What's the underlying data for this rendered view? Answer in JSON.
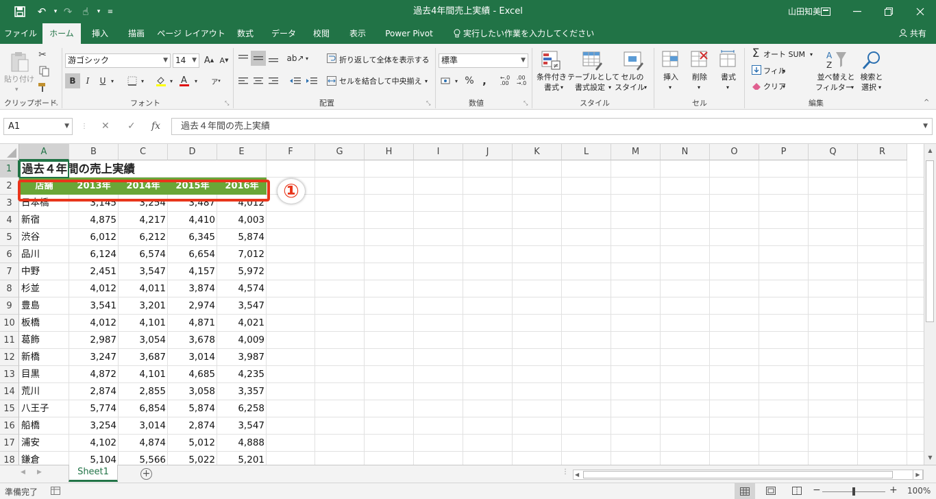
{
  "window": {
    "title": "過去4年間売上実績  -  Excel",
    "user": "山田知美"
  },
  "quick_access": {
    "save_icon": "save-icon",
    "undo_icon": "undo-icon",
    "redo_icon": "redo-icon",
    "touch_icon": "touch-mode-icon",
    "customize_icon": "customize-icon"
  },
  "tabs": [
    {
      "label": "ファイル"
    },
    {
      "label": "ホーム"
    },
    {
      "label": "挿入"
    },
    {
      "label": "描画"
    },
    {
      "label": "ページ レイアウト"
    },
    {
      "label": "数式"
    },
    {
      "label": "データ"
    },
    {
      "label": "校閲"
    },
    {
      "label": "表示"
    },
    {
      "label": "Power Pivot"
    },
    {
      "label": "実行したい作業を入力してください"
    }
  ],
  "share_label": "共有",
  "ribbon": {
    "clipboard": {
      "label": "クリップボード",
      "paste": "貼り付け"
    },
    "font": {
      "label": "フォント",
      "font_name": "游ゴシック",
      "font_size": "14",
      "bold": "B",
      "italic": "I",
      "underline": "U"
    },
    "alignment": {
      "label": "配置",
      "wrap": "折り返して全体を表示する",
      "merge": "セルを結合して中央揃え"
    },
    "number": {
      "label": "数値",
      "format": "標準",
      "percent": "%",
      "comma": ","
    },
    "styles": {
      "label": "スタイル",
      "conditional_1": "条件付き",
      "conditional_2": "書式",
      "table_1": "テーブルとして",
      "table_2": "書式設定",
      "cell_1": "セルの",
      "cell_2": "スタイル"
    },
    "cells": {
      "label": "セル",
      "insert": "挿入",
      "delete": "削除",
      "format": "書式"
    },
    "editing": {
      "label": "編集",
      "autosum": "オート SUM",
      "fill": "フィル",
      "clear": "クリア",
      "sort_1": "並べ替えと",
      "sort_2": "フィルター",
      "find_1": "検索と",
      "find_2": "選択"
    }
  },
  "formula_bar": {
    "name_box": "A1",
    "cancel": "✕",
    "enter": "✓",
    "fx": "fx",
    "content": "過去４年間の売上実績"
  },
  "sheet": {
    "columns": [
      "A",
      "B",
      "C",
      "D",
      "E",
      "F",
      "G",
      "H",
      "I",
      "J",
      "K",
      "L",
      "M",
      "N",
      "O",
      "P",
      "Q",
      "R"
    ],
    "row_numbers": [
      "1",
      "2",
      "3",
      "4",
      "5",
      "6",
      "7",
      "8",
      "9",
      "10",
      "11",
      "12",
      "13",
      "14",
      "15",
      "16",
      "17",
      "18"
    ],
    "title": "過去４年間の売上実績",
    "headers": [
      "店舗",
      "2013年",
      "2014年",
      "2015年",
      "2016年"
    ],
    "rows": [
      [
        "日本橋",
        "3,145",
        "3,254",
        "3,487",
        "4,012"
      ],
      [
        "新宿",
        "4,875",
        "4,217",
        "4,410",
        "4,003"
      ],
      [
        "渋谷",
        "6,012",
        "6,212",
        "6,345",
        "5,874"
      ],
      [
        "品川",
        "6,124",
        "6,574",
        "6,654",
        "7,012"
      ],
      [
        "中野",
        "2,451",
        "3,547",
        "4,157",
        "5,972"
      ],
      [
        "杉並",
        "4,012",
        "4,011",
        "3,874",
        "4,574"
      ],
      [
        "豊島",
        "3,541",
        "3,201",
        "2,974",
        "3,547"
      ],
      [
        "板橋",
        "4,012",
        "4,101",
        "4,871",
        "4,021"
      ],
      [
        "葛飾",
        "2,987",
        "3,054",
        "3,678",
        "4,009"
      ],
      [
        "新橋",
        "3,247",
        "3,687",
        "3,014",
        "3,987"
      ],
      [
        "目黒",
        "4,872",
        "4,101",
        "4,685",
        "4,235"
      ],
      [
        "荒川",
        "2,874",
        "2,855",
        "3,058",
        "3,357"
      ],
      [
        "八王子",
        "5,774",
        "6,854",
        "5,874",
        "6,258"
      ],
      [
        "船橋",
        "3,254",
        "3,014",
        "2,874",
        "3,547"
      ],
      [
        "浦安",
        "4,102",
        "4,874",
        "5,012",
        "4,888"
      ],
      [
        "鎌倉",
        "5,104",
        "5,566",
        "5,022",
        "5,201"
      ]
    ]
  },
  "sheet_tab": "Sheet1",
  "status": {
    "ready": "準備完了",
    "zoom": "100%",
    "zoom_minus": "−",
    "zoom_plus": "+"
  },
  "annotation": {
    "marker": "①"
  },
  "colors": {
    "excel_green": "#217346",
    "header_fill": "#6aa637",
    "annotation_red": "#e8351a"
  }
}
